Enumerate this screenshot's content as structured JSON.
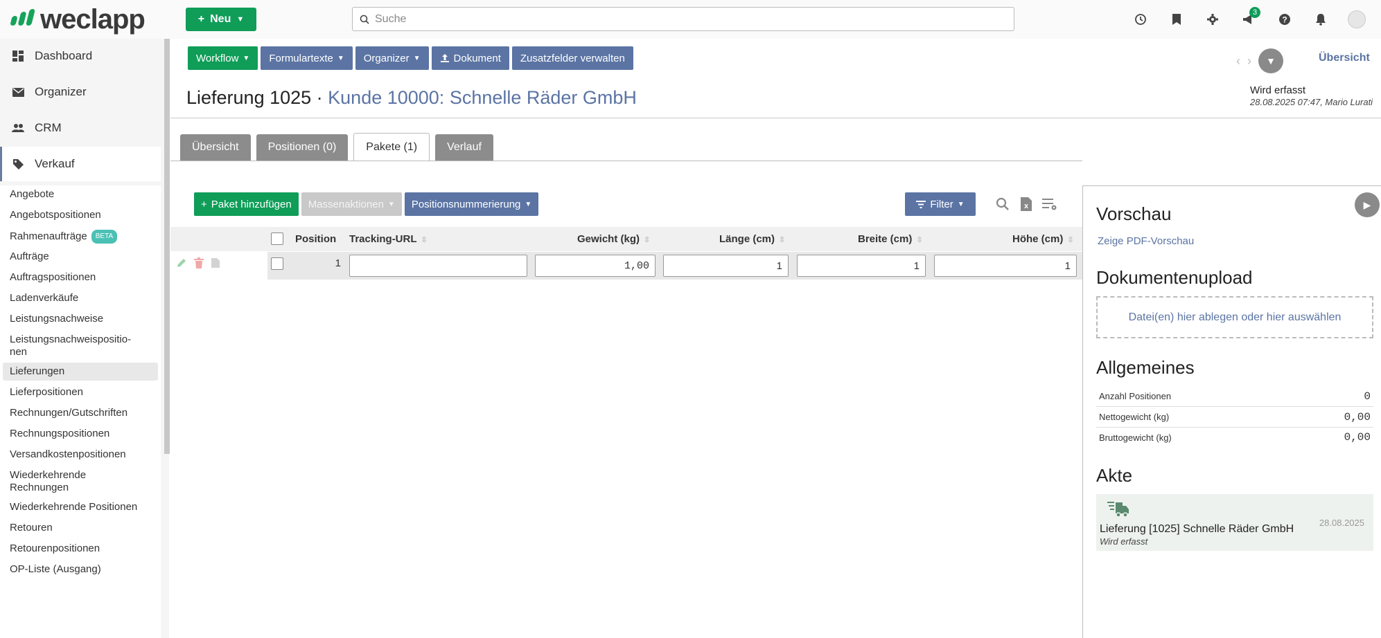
{
  "app": {
    "logo_text": "weclapp",
    "new_button": "Neu",
    "search_placeholder": "Suche",
    "notification_count": "3"
  },
  "sidebar": {
    "main": [
      {
        "label": "Dashboard",
        "icon": "dashboard-icon"
      },
      {
        "label": "Organizer",
        "icon": "mail-icon"
      },
      {
        "label": "CRM",
        "icon": "people-icon"
      },
      {
        "label": "Verkauf",
        "icon": "tag-icon"
      }
    ],
    "sub": [
      {
        "label": "Angebote"
      },
      {
        "label": "Angebotspositionen"
      },
      {
        "label": "Rahmenaufträge",
        "badge": "BETA"
      },
      {
        "label": "Aufträge"
      },
      {
        "label": "Auftragspositionen"
      },
      {
        "label": "Ladenverkäufe"
      },
      {
        "label": "Leistungsnachweise"
      },
      {
        "label": "Leistungsnachweispositio-\nnen"
      },
      {
        "label": "Lieferungen"
      },
      {
        "label": "Lieferpositionen"
      },
      {
        "label": "Rechnungen/Gutschriften"
      },
      {
        "label": "Rechnungspositionen"
      },
      {
        "label": "Versandkostenpositionen"
      },
      {
        "label": "Wiederkehrende Rechnungen"
      },
      {
        "label": "Wiederkehrende Positionen"
      },
      {
        "label": "Retouren"
      },
      {
        "label": "Retourenpositionen"
      },
      {
        "label": "OP-Liste (Ausgang)"
      }
    ]
  },
  "toolbar": {
    "workflow": "Workflow",
    "formulartexte": "Formulartexte",
    "organizer": "Organizer",
    "dokument": "Dokument",
    "zusatzfelder": "Zusatzfelder verwalten",
    "overview": "Übersicht"
  },
  "header": {
    "title_prefix": "Lieferung 1025 · ",
    "customer": "Kunde 10000: Schnelle Räder GmbH",
    "status": "Wird erfasst",
    "status_meta": "28.08.2025 07:47, Mario Lurati"
  },
  "tabs": [
    {
      "label": "Übersicht"
    },
    {
      "label": "Positionen (0)"
    },
    {
      "label": "Pakete (1)"
    },
    {
      "label": "Verlauf"
    }
  ],
  "table": {
    "add_button": "Paket hinzufügen",
    "mass_actions": "Massenaktionen",
    "numbering": "Positionsnummerierung",
    "filter": "Filter",
    "columns": {
      "position": "Position",
      "tracking": "Tracking-URL",
      "weight": "Gewicht (kg)",
      "length": "Länge (cm)",
      "width": "Breite (cm)",
      "height": "Höhe (cm)"
    },
    "rows": [
      {
        "position": "1",
        "tracking": "",
        "weight": "1,00",
        "length": "1",
        "width": "1",
        "height": "1"
      }
    ]
  },
  "panel": {
    "preview_title": "Vorschau",
    "preview_link": "Zeige PDF-Vorschau",
    "upload_title": "Dokumentenupload",
    "upload_drop": "Datei(en) hier ablegen oder hier auswählen",
    "general_title": "Allgemeines",
    "general": [
      {
        "key": "Anzahl Positionen",
        "value": "0"
      },
      {
        "key": "Nettogewicht (kg)",
        "value": "0,00"
      },
      {
        "key": "Bruttogewicht (kg)",
        "value": "0,00"
      }
    ],
    "akte_title": "Akte",
    "akte_entry": {
      "title": "Lieferung [1025] Schnelle Räder GmbH",
      "status": "Wird erfasst",
      "date": "28.08.2025"
    }
  }
}
